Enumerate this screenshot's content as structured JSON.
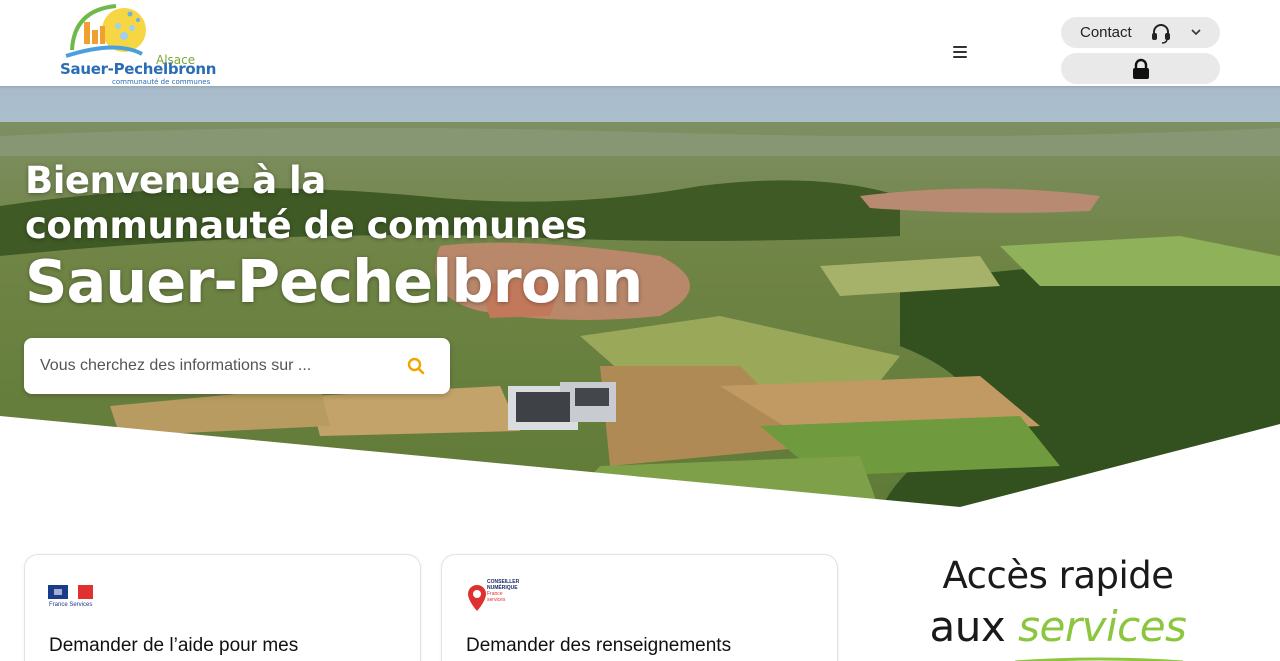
{
  "header": {
    "logo": {
      "alsace": "Alsace",
      "name": "Sauer-Pechelbronn",
      "sub": "communauté de communes"
    },
    "menu_icon": "hamburger-icon",
    "contact": {
      "label": "Contact",
      "icon": "headset-icon",
      "chevron": "chevron-down-icon"
    },
    "login": {
      "icon": "lock-icon"
    }
  },
  "hero": {
    "line1": "Bienvenue à la",
    "line2": "communauté de communes",
    "line3": "Sauer-Pechelbronn",
    "search": {
      "placeholder": "Vous cherchez des informations sur ...",
      "value": "",
      "icon": "search-icon"
    }
  },
  "cards": [
    {
      "logo_text": "France Services",
      "title": "Demander de l’aide pour mes"
    },
    {
      "logo_text": "CONSEILLER NUMÉRIQUE France services",
      "logo_line1": "CONSEILLER",
      "logo_line2": "NUMÉRIQUE",
      "logo_line3": "France",
      "logo_line4": "services",
      "title": "Demander des renseignements"
    }
  ],
  "quick_access": {
    "line1": "Accès rapide",
    "line2_prefix": "aux ",
    "line2_highlight": "services"
  },
  "colors": {
    "accent_green": "#8cc63f",
    "search_icon": "#f0a500",
    "logo_blue": "#2a6db5"
  }
}
